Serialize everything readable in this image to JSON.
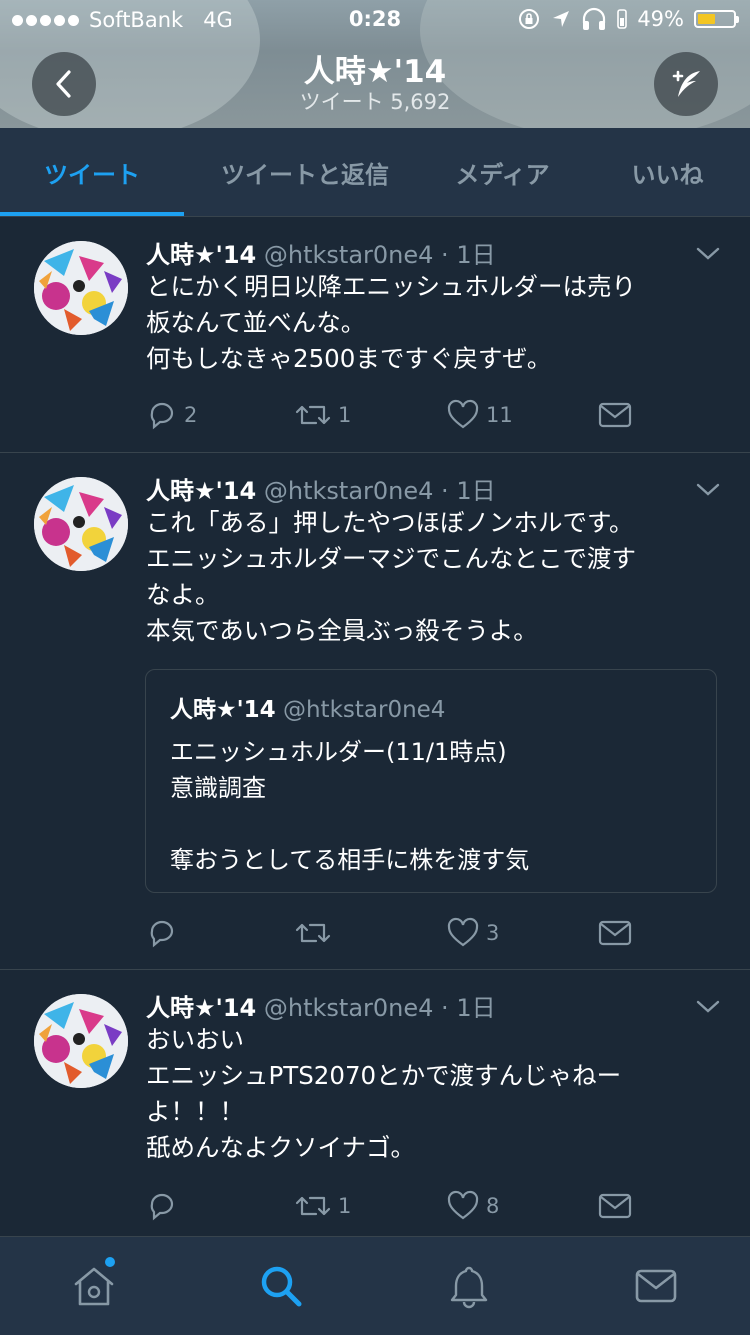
{
  "status": {
    "carrier": "SoftBank",
    "network": "4G",
    "time": "0:28",
    "battery": "49%",
    "battery_level": 0.49
  },
  "profile": {
    "name": "人時★'14",
    "tweet_count": "ツイート 5,692"
  },
  "tabs": [
    {
      "label": "ツイート",
      "active": true
    },
    {
      "label": "ツイートと返信",
      "active": false
    },
    {
      "label": "メディア",
      "active": false
    },
    {
      "label": "いいね",
      "active": false
    }
  ],
  "tweets": [
    {
      "name": "人時★'14",
      "handle": "@htkstar0ne4 · 1日",
      "text": "とにかく明日以降エニッシュホルダーは売り\n板なんて並べんな。\n何もしなきゃ2500まですぐ戻すぜ。",
      "replies": "2",
      "retweets": "1",
      "likes": "11"
    },
    {
      "name": "人時★'14",
      "handle": "@htkstar0ne4 · 1日",
      "text": "これ「ある」押したやつほぼノンホルです。\nエニッシュホルダーマジでこんなとこで渡す\nなよ。\n本気であいつら全員ぶっ殺そうよ。",
      "quote": {
        "name": "人時★'14",
        "handle": "@htkstar0ne4",
        "text": "エニッシュホルダー(11/1時点)\n意識調査\n\n奪おうとしてる相手に株を渡す気"
      },
      "replies": "",
      "retweets": "",
      "likes": "3"
    },
    {
      "name": "人時★'14",
      "handle": "@htkstar0ne4 · 1日",
      "text": "おいおい\nエニッシュPTS2070とかで渡すんじゃねー\nよ！！！\n舐めんなよクソイナゴ。",
      "replies": "",
      "retweets": "1",
      "likes": "8"
    }
  ],
  "colors": {
    "background": "#1b2836",
    "bar": "#243447",
    "accent": "#1da1f2",
    "secondary_text": "#8899a6",
    "divider": "#38444d"
  },
  "icons": {
    "nav": [
      "home-icon",
      "search-icon",
      "bell-icon",
      "mail-icon"
    ],
    "actions": [
      "reply-icon",
      "retweet-icon",
      "like-icon",
      "dm-icon"
    ]
  }
}
